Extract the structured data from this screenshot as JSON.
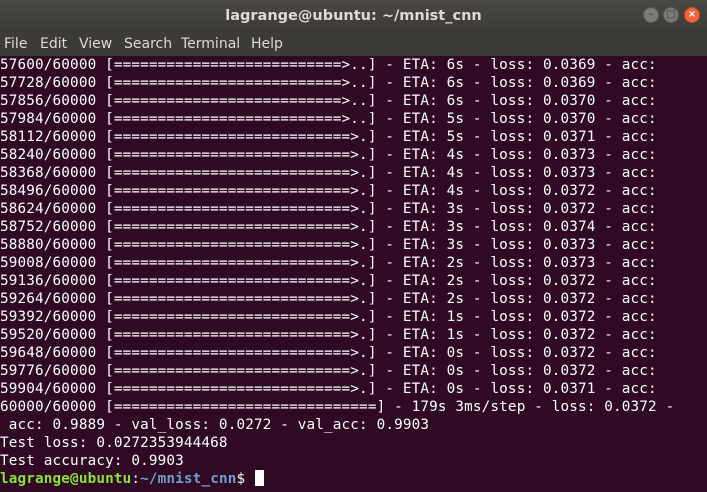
{
  "window": {
    "title": "lagrange@ubuntu: ~/mnist_cnn",
    "controls": {
      "minimize_icon": "minimize-icon",
      "maximize_icon": "maximize-icon",
      "close_icon": "close-icon"
    }
  },
  "menu": [
    "File",
    "Edit",
    "View",
    "Search",
    "Terminal",
    "Help"
  ],
  "terminal": {
    "lines": [
      "57600/60000 [==========================>..] - ETA: 6s - loss: 0.0369 - acc:",
      "57728/60000 [==========================>..] - ETA: 6s - loss: 0.0369 - acc:",
      "57856/60000 [==========================>..] - ETA: 6s - loss: 0.0370 - acc:",
      "57984/60000 [==========================>..] - ETA: 5s - loss: 0.0370 - acc:",
      "58112/60000 [===========================>.] - ETA: 5s - loss: 0.0371 - acc:",
      "58240/60000 [===========================>.] - ETA: 4s - loss: 0.0373 - acc:",
      "58368/60000 [===========================>.] - ETA: 4s - loss: 0.0373 - acc:",
      "58496/60000 [===========================>.] - ETA: 4s - loss: 0.0372 - acc:",
      "58624/60000 [===========================>.] - ETA: 3s - loss: 0.0372 - acc:",
      "58752/60000 [===========================>.] - ETA: 3s - loss: 0.0374 - acc:",
      "58880/60000 [===========================>.] - ETA: 3s - loss: 0.0373 - acc:",
      "59008/60000 [===========================>.] - ETA: 2s - loss: 0.0373 - acc:",
      "59136/60000 [===========================>.] - ETA: 2s - loss: 0.0372 - acc:",
      "59264/60000 [===========================>.] - ETA: 2s - loss: 0.0372 - acc:",
      "59392/60000 [===========================>.] - ETA: 1s - loss: 0.0372 - acc:",
      "59520/60000 [===========================>.] - ETA: 1s - loss: 0.0372 - acc:",
      "59648/60000 [===========================>.] - ETA: 0s - loss: 0.0372 - acc:",
      "59776/60000 [===========================>.] - ETA: 0s - loss: 0.0372 - acc:",
      "59904/60000 [===========================>.] - ETA: 0s - loss: 0.0371 - acc:",
      "60000/60000 [==============================] - 179s 3ms/step - loss: 0.0372 -",
      " acc: 0.9889 - val_loss: 0.0272 - val_acc: 0.9903",
      "Test loss: 0.0272353944468",
      "Test accuracy: 0.9903"
    ],
    "prompt": {
      "user_host": "lagrange@ubuntu",
      "separator": ":",
      "path": "~/mnist_cnn",
      "symbol": "$ "
    }
  }
}
